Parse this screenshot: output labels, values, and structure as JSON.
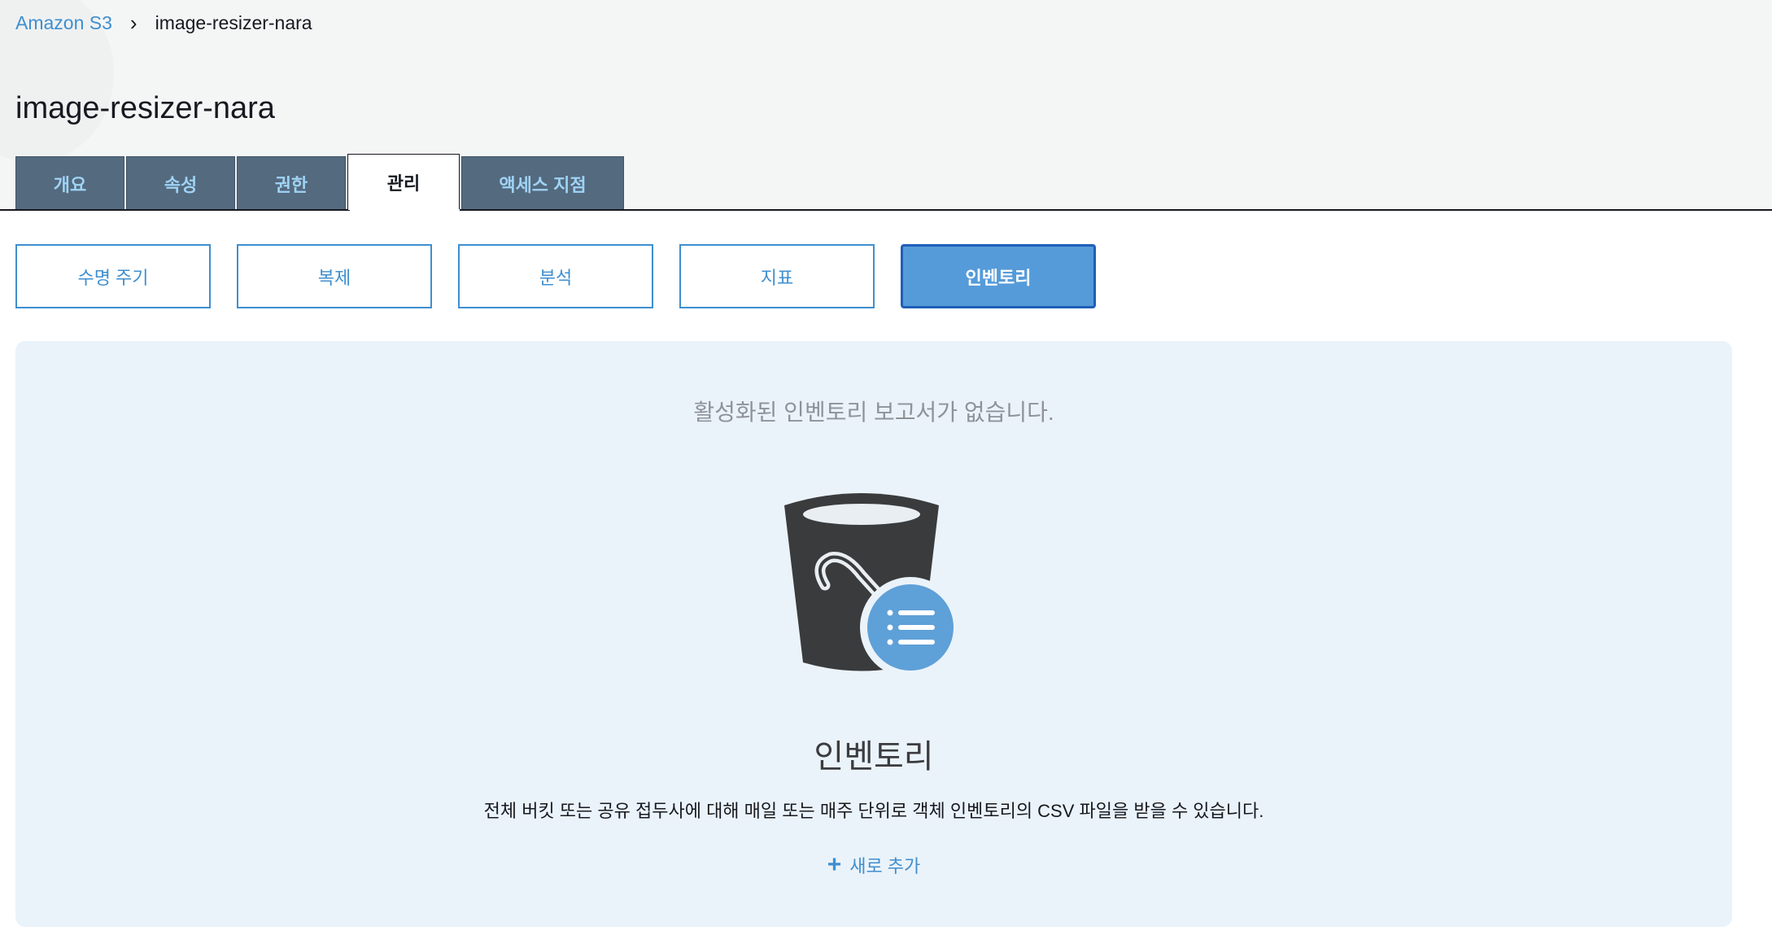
{
  "breadcrumb": {
    "root": "Amazon S3",
    "separator": "›",
    "current": "image-resizer-nara"
  },
  "page_title": "image-resizer-nara",
  "tabs": [
    {
      "label": "개요",
      "active": false
    },
    {
      "label": "속성",
      "active": false
    },
    {
      "label": "권한",
      "active": false
    },
    {
      "label": "관리",
      "active": true
    },
    {
      "label": "액세스 지점",
      "active": false
    }
  ],
  "subtabs": [
    {
      "label": "수명 주기",
      "active": false
    },
    {
      "label": "복제",
      "active": false
    },
    {
      "label": "분석",
      "active": false
    },
    {
      "label": "지표",
      "active": false
    },
    {
      "label": "인벤토리",
      "active": true
    }
  ],
  "empty_state": {
    "message": "활성화된 인벤토리 보고서가 없습니다.",
    "illustration_icon": "bucket-list-icon",
    "title": "인벤토리",
    "description": "전체 버킷 또는 공유 접두사에 대해 매일 또는 매주 단위로 객체 인벤토리의 CSV 파일을 받을 수 있습니다.",
    "add_icon": "plus-icon",
    "add_label": "새로 추가"
  },
  "colors": {
    "link": "#3f8fcf",
    "tab_inactive_bg": "#546a7e",
    "tab_inactive_text": "#9fd3f5",
    "subtab_active_bg": "#559bd9",
    "panel_bg": "#ebf3fa",
    "bucket_dark": "#3a3b3d",
    "badge_blue": "#5ea0d8"
  }
}
